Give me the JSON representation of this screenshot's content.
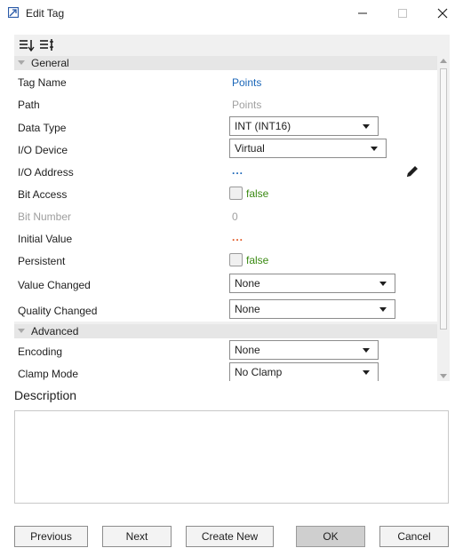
{
  "window": {
    "title": "Edit Tag"
  },
  "toolbar": {
    "sort_icon": "sort-categorized-icon",
    "sort_alpha_icon": "sort-alphabetical-icon"
  },
  "categories": {
    "general": "General",
    "advanced": "Advanced"
  },
  "properties": {
    "tag_name": {
      "label": "Tag Name",
      "value": "Points"
    },
    "path": {
      "label": "Path",
      "value": "Points"
    },
    "data_type": {
      "label": "Data Type",
      "value": "INT (INT16)"
    },
    "io_device": {
      "label": "I/O Device",
      "value": "Virtual"
    },
    "io_address": {
      "label": "I/O Address",
      "value": "..."
    },
    "bit_access": {
      "label": "Bit Access",
      "value": "false"
    },
    "bit_number": {
      "label": "Bit Number",
      "value": "0"
    },
    "initial_value": {
      "label": "Initial Value",
      "value": "..."
    },
    "persistent": {
      "label": "Persistent",
      "value": "false"
    },
    "value_changed": {
      "label": "Value Changed",
      "value": "None"
    },
    "quality_changed": {
      "label": "Quality Changed",
      "value": "None"
    },
    "encoding": {
      "label": "Encoding",
      "value": "None"
    },
    "clamp_mode": {
      "label": "Clamp Mode",
      "value": "No Clamp"
    }
  },
  "description": {
    "label": "Description",
    "value": ""
  },
  "buttons": {
    "previous": "Previous",
    "next": "Next",
    "create_new": "Create New",
    "ok": "OK",
    "cancel": "Cancel"
  },
  "colors": {
    "link": "#1a66b8",
    "bool_false": "#3a8a12",
    "placeholder": "#e0531e",
    "category_bg": "#e6e6e6"
  }
}
